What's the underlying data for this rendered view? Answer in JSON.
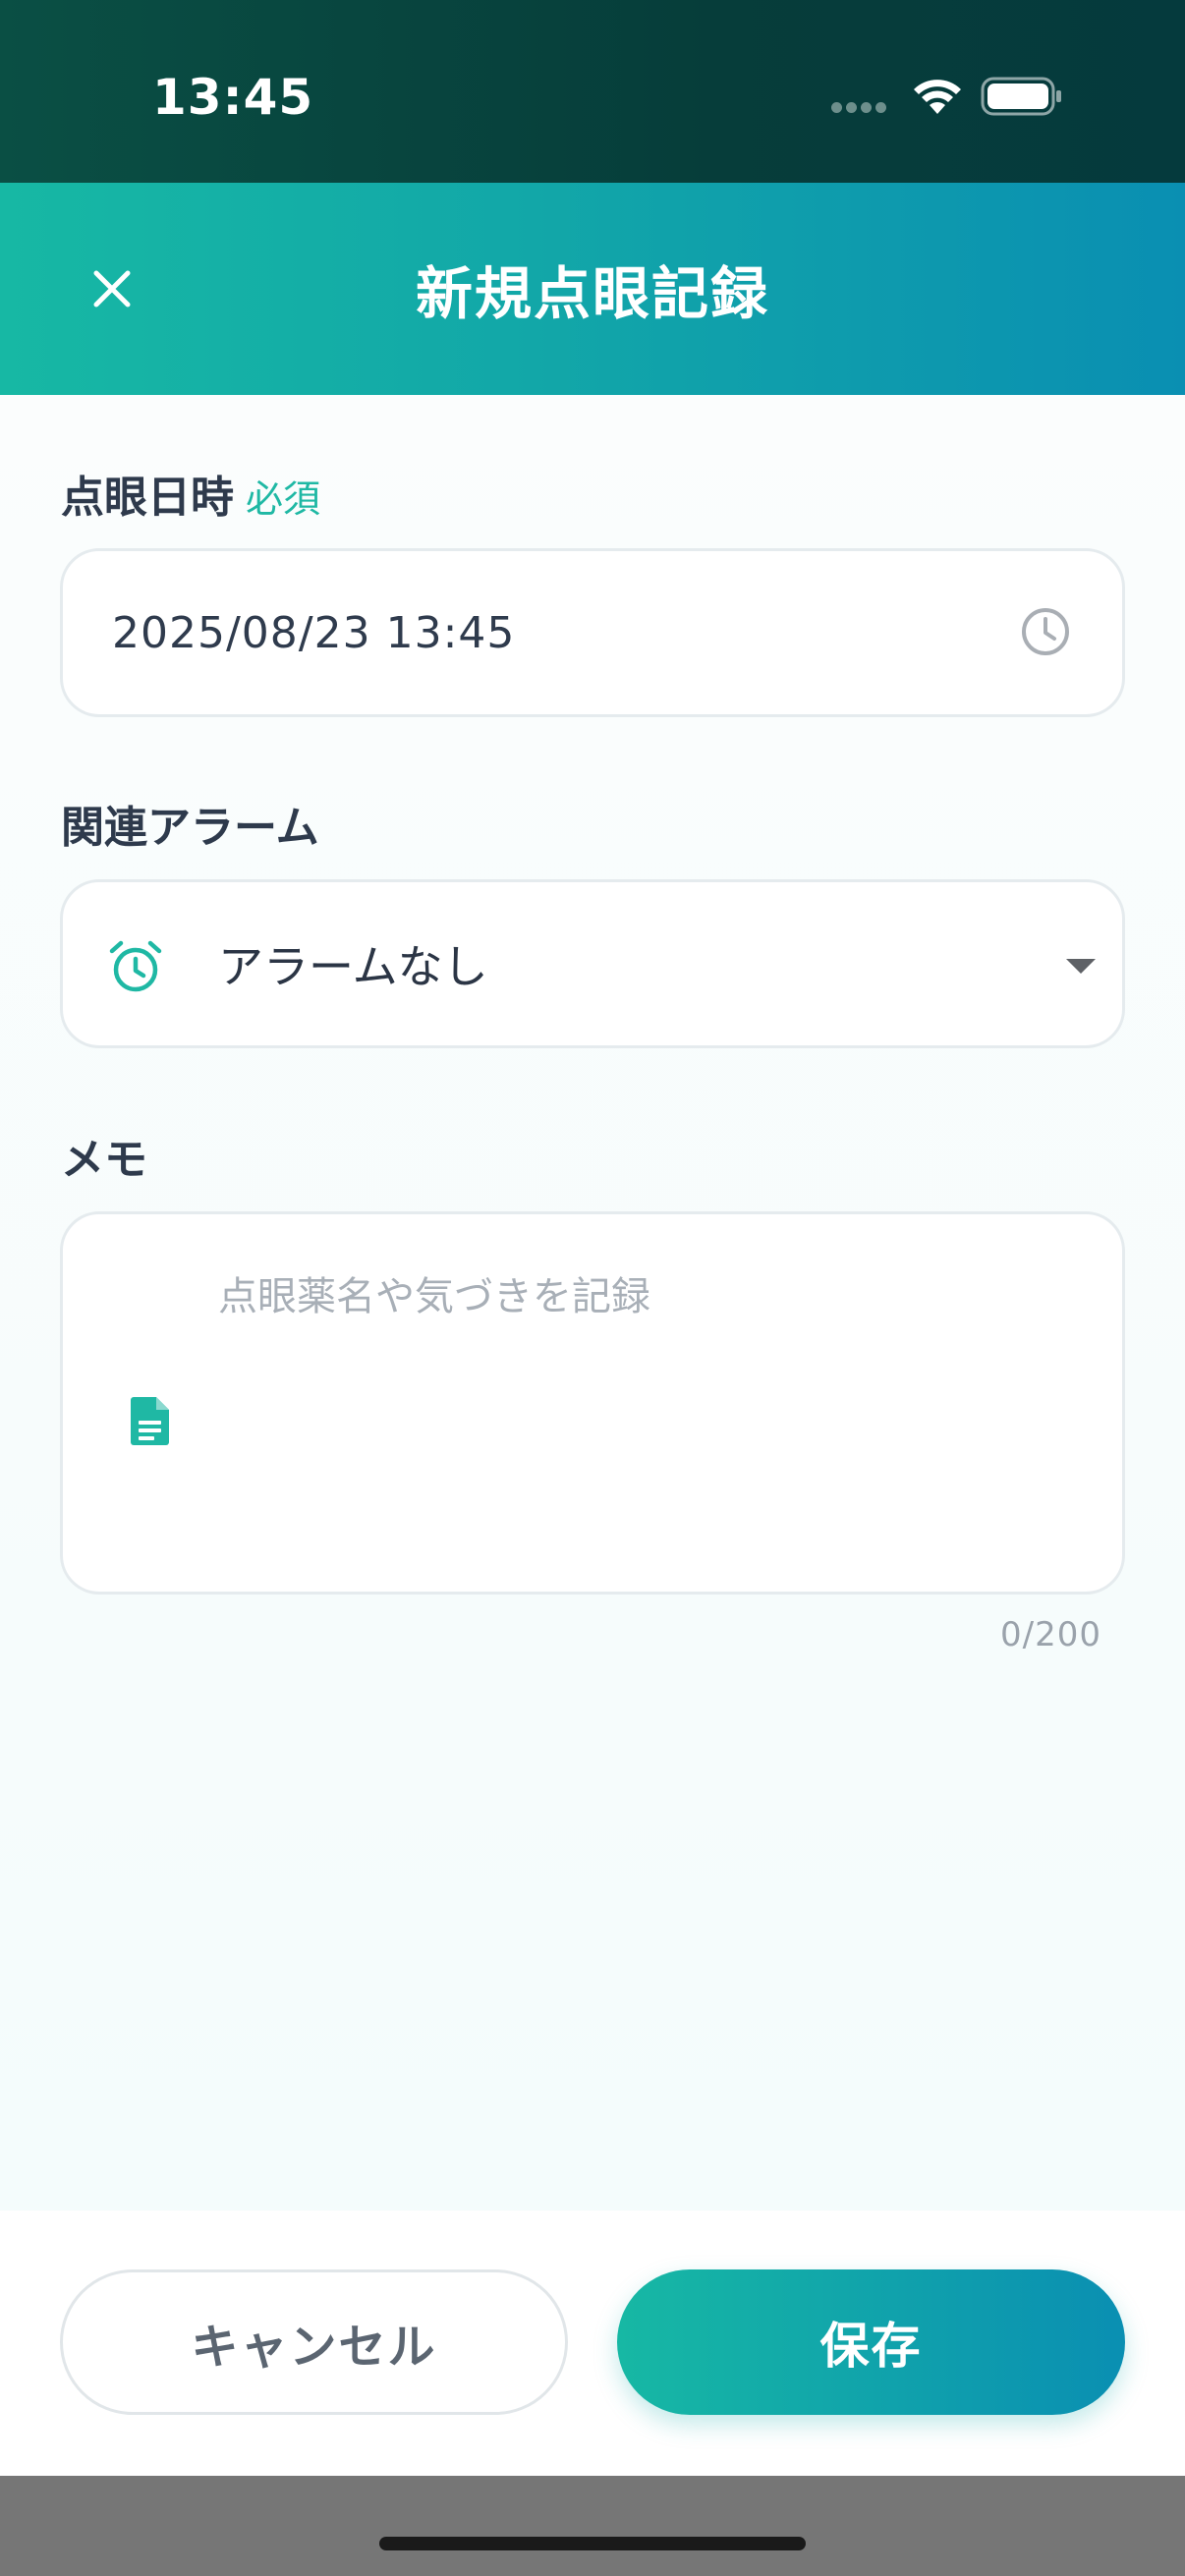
{
  "status_bar": {
    "time": "13:45"
  },
  "header": {
    "title": "新規点眼記録",
    "close_icon": "close-icon"
  },
  "form": {
    "datetime": {
      "label": "点眼日時",
      "required_tag": "必須",
      "value": "2025/08/23 13:45",
      "icon": "clock-icon"
    },
    "alarm": {
      "label": "関連アラーム",
      "selected": "アラームなし",
      "icon": "alarm-clock-icon"
    },
    "memo": {
      "label": "メモ",
      "placeholder": "点眼薬名や気づきを記録",
      "value": "",
      "counter": "0/200",
      "icon": "document-icon"
    }
  },
  "footer": {
    "cancel_label": "キャンセル",
    "save_label": "保存"
  },
  "colors": {
    "accent": "#1fb8a4",
    "gradient_start": "#17b8a4",
    "gradient_end": "#0a8fb2",
    "status_bar_bg": "#063d3a"
  }
}
